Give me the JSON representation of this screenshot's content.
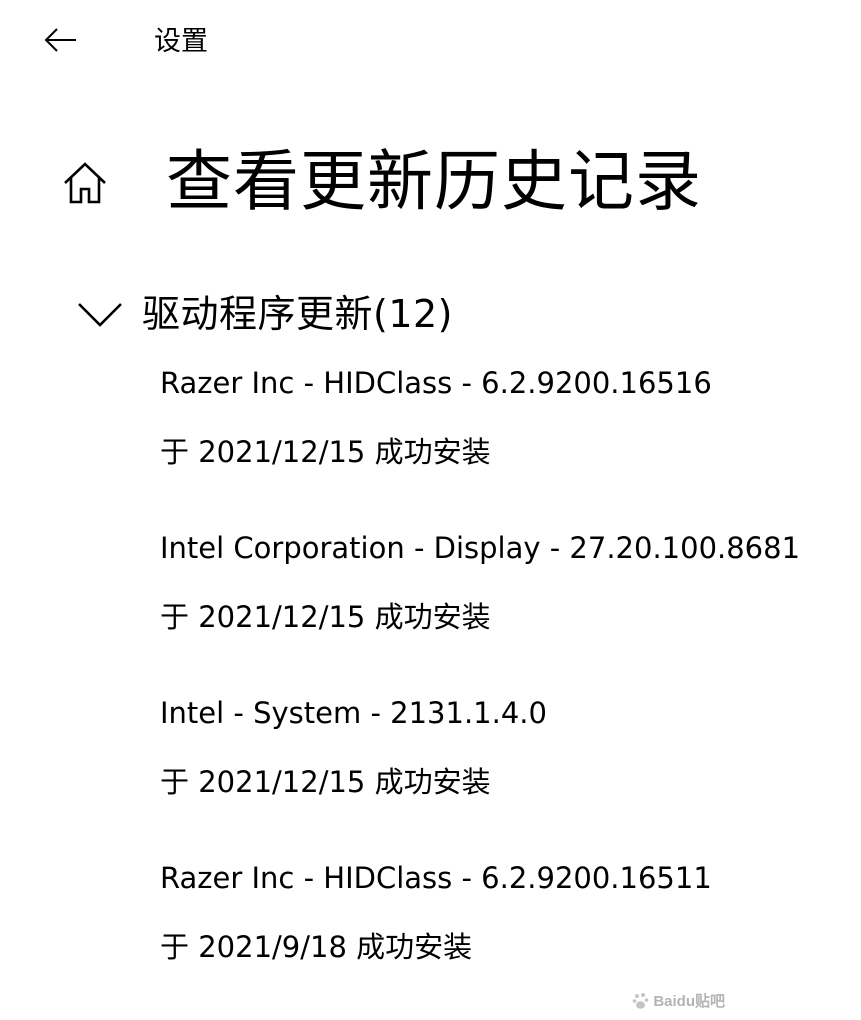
{
  "header": {
    "back_icon": "back-arrow-icon",
    "title": "设置"
  },
  "page": {
    "home_icon": "home-icon",
    "title": "查看更新历史记录"
  },
  "section": {
    "icon": "chevron-down-icon",
    "title": "驱动程序更新(12)",
    "updates": [
      {
        "name": "Razer Inc - HIDClass - 6.2.9200.16516",
        "status": "于 2021/12/15 成功安装"
      },
      {
        "name": "Intel Corporation - Display - 27.20.100.8681",
        "status": "于 2021/12/15 成功安装"
      },
      {
        "name": "Intel - System - 2131.1.4.0",
        "status": "于 2021/12/15 成功安装"
      },
      {
        "name": "Razer Inc - HIDClass - 6.2.9200.16511",
        "status": "于 2021/9/18 成功安装"
      }
    ]
  },
  "watermark": {
    "icon": "baidu-paw-logo",
    "text": "Baidu贴吧"
  }
}
